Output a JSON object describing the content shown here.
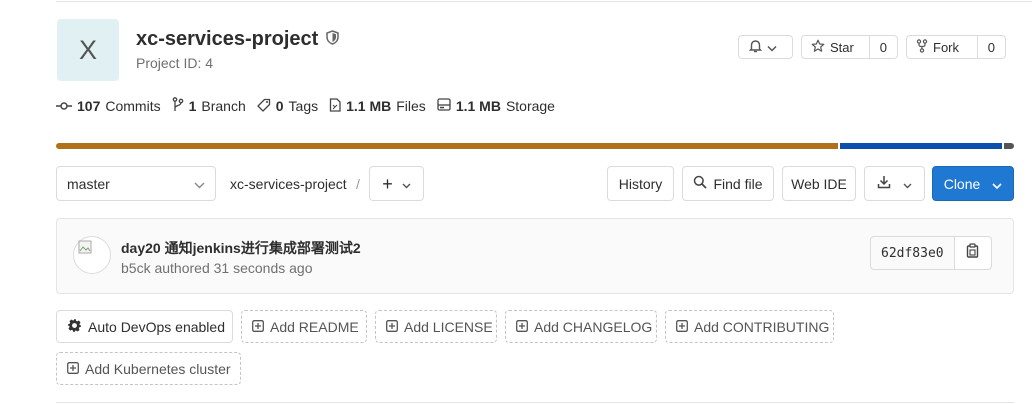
{
  "project": {
    "avatar_letter": "X",
    "name": "xc-services-project",
    "id_label": "Project ID: 4"
  },
  "actions": {
    "star_label": "Star",
    "star_count": "0",
    "fork_label": "Fork",
    "fork_count": "0"
  },
  "stats": [
    {
      "icon": "commit-icon",
      "value": "107",
      "label": "Commits"
    },
    {
      "icon": "branch-icon",
      "value": "1",
      "label": "Branch"
    },
    {
      "icon": "tag-icon",
      "value": "0",
      "label": "Tags"
    },
    {
      "icon": "file-icon",
      "value": "1.1 MB",
      "label": "Files"
    },
    {
      "icon": "storage-icon",
      "value": "1.1 MB",
      "label": "Storage"
    }
  ],
  "languages": [
    {
      "share": 82,
      "color": "#b07219"
    },
    {
      "share": 17,
      "color": "#0b50ad"
    },
    {
      "share": 1,
      "color": "#555555"
    }
  ],
  "toolbar": {
    "branch": "master",
    "path": "xc-services-project",
    "separator": "/",
    "add": "+",
    "history": "History",
    "find_file": "Find file",
    "web_ide": "Web IDE",
    "clone": "Clone"
  },
  "commit": {
    "message": "day20 通知jenkins进行集成部署测试2",
    "author": "b5ck",
    "meta_suffix": "authored 31 seconds ago",
    "sha": "62df83e0"
  },
  "quick_actions": [
    {
      "label": "Auto DevOps enabled",
      "icon": "gear-icon"
    },
    {
      "label": "Add README",
      "icon": "plus-square-icon"
    },
    {
      "label": "Add LICENSE",
      "icon": "plus-square-icon"
    },
    {
      "label": "Add CHANGELOG",
      "icon": "plus-square-icon"
    },
    {
      "label": "Add CONTRIBUTING",
      "icon": "plus-square-icon"
    },
    {
      "label": "Add Kubernetes cluster",
      "icon": "plus-square-icon"
    }
  ],
  "colors": {
    "primary": "#1f78d1",
    "avatar_bg": "#e1f1f3"
  }
}
